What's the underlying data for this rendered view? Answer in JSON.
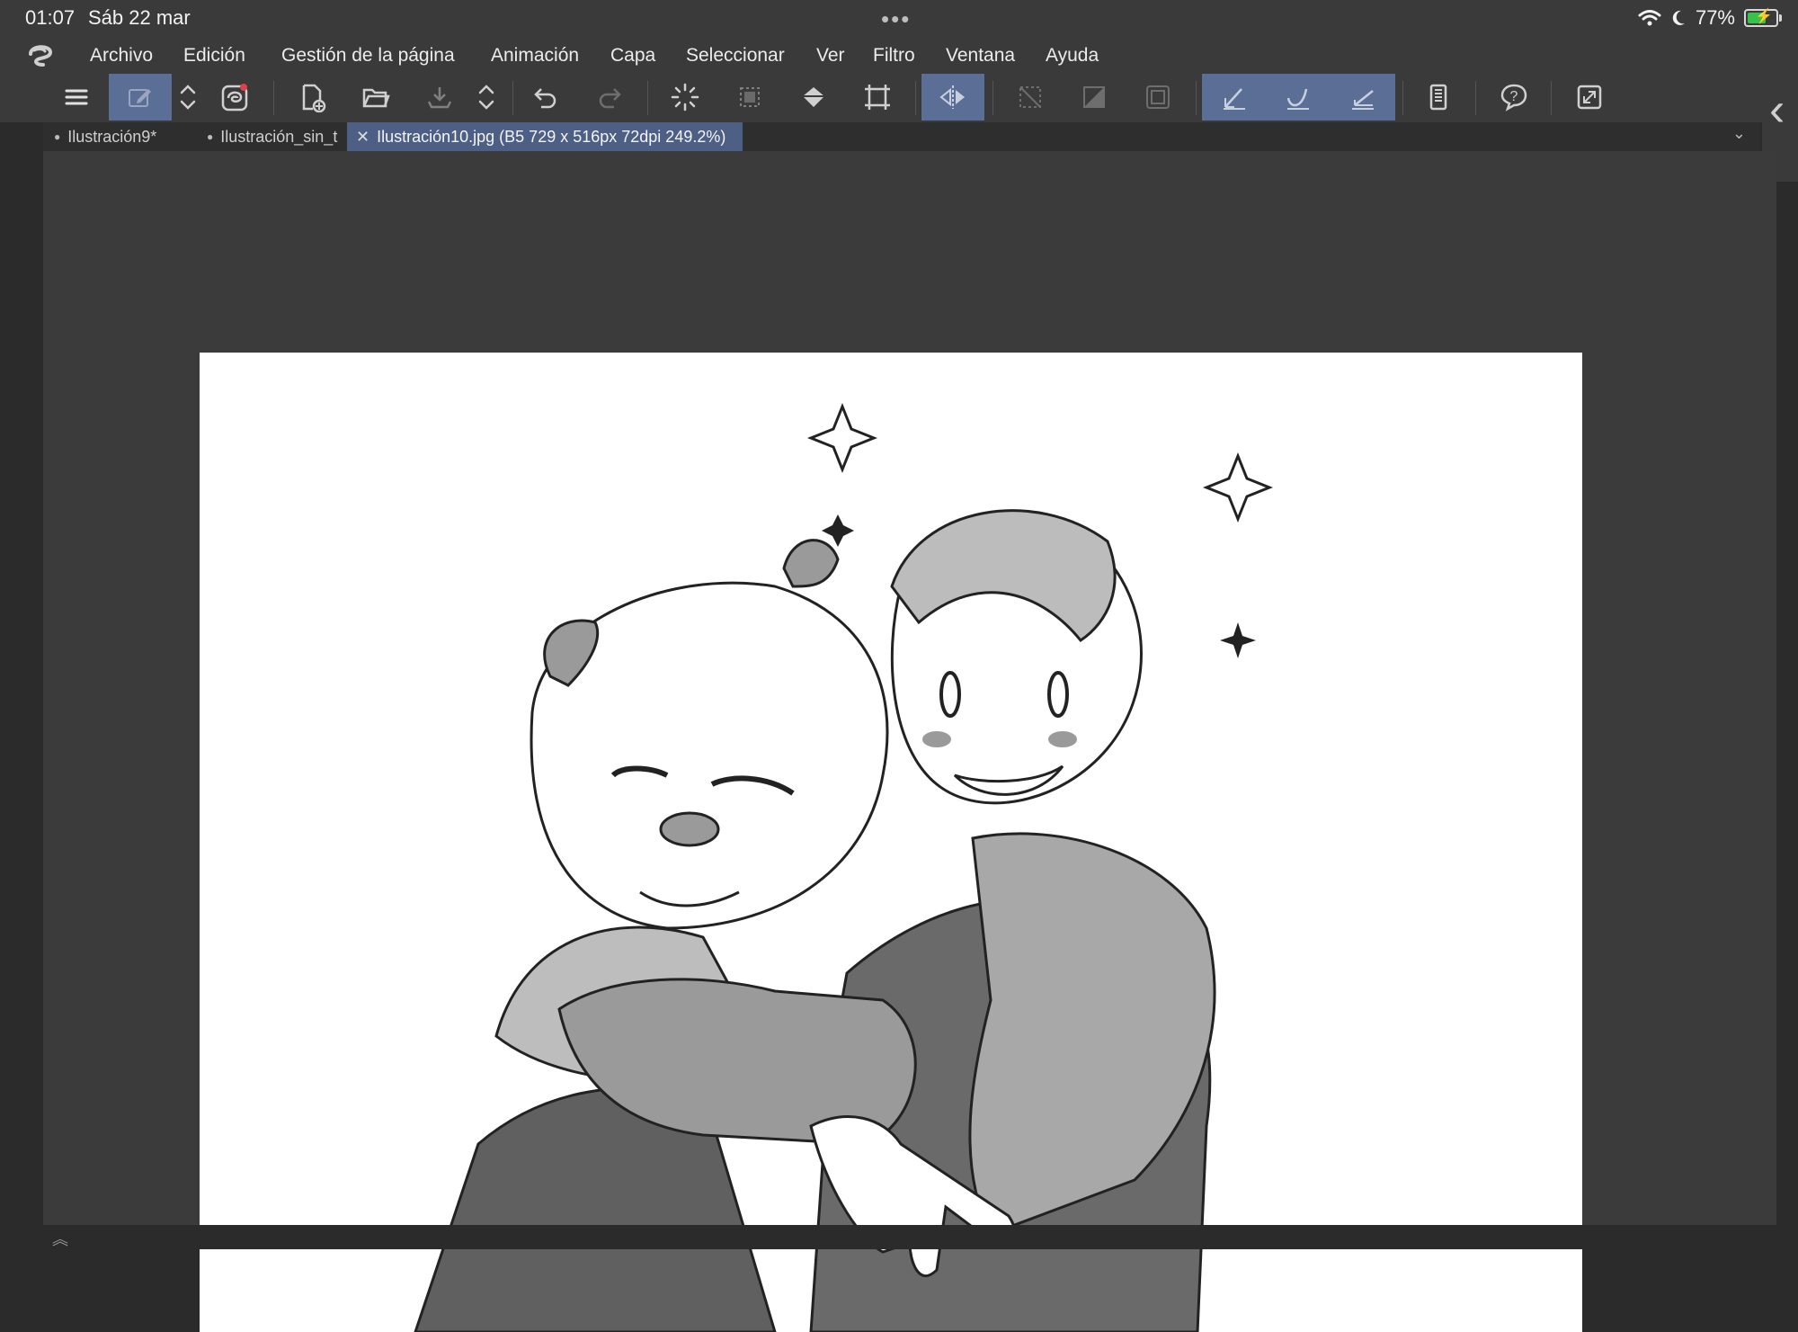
{
  "status_bar": {
    "time": "01:07",
    "date": "Sáb 22 mar",
    "dots": "•••",
    "battery_percent": "77%",
    "battery_level": 0.77,
    "icons": [
      "wifi-icon",
      "moon-icon",
      "battery-charging-icon"
    ]
  },
  "menu": {
    "items": [
      "Archivo",
      "Edición",
      "Gestión de la página",
      "Animación",
      "Capa",
      "Seleccionar",
      "Ver",
      "Filtro",
      "Ventana",
      "Ayuda"
    ]
  },
  "toolbar": {
    "icons": [
      "hamburger-menu-icon",
      "pen-tool-icon",
      "up-down-arrows-icon",
      "companion-icon",
      "new-file-icon",
      "open-folder-icon",
      "save-icon",
      "up-down-arrows-icon",
      "undo-icon",
      "redo-icon",
      "loading-spinner-icon",
      "selection-icon",
      "fill-bucket-icon",
      "transform-icon",
      "flip-horizontal-icon",
      "deselect-icon",
      "invert-selection-icon",
      "frame-icon",
      "pen-pressure-icon",
      "brush-curve-icon",
      "ruler-icon",
      "device-icon",
      "help-icon",
      "fullscreen-icon"
    ]
  },
  "tabs": [
    {
      "label": "Ilustración9*",
      "active": false
    },
    {
      "label": "Ilustración_sin_t",
      "active": false
    },
    {
      "label": "Ilustración10.jpg (B5 729 x 516px 72dpi 249.2%)",
      "active": true
    }
  ],
  "colors": {
    "accent": "#5a6e96",
    "panel": "#3a3a3a",
    "workspace": "#3b3b3b",
    "battery_green": "#39c24a"
  }
}
